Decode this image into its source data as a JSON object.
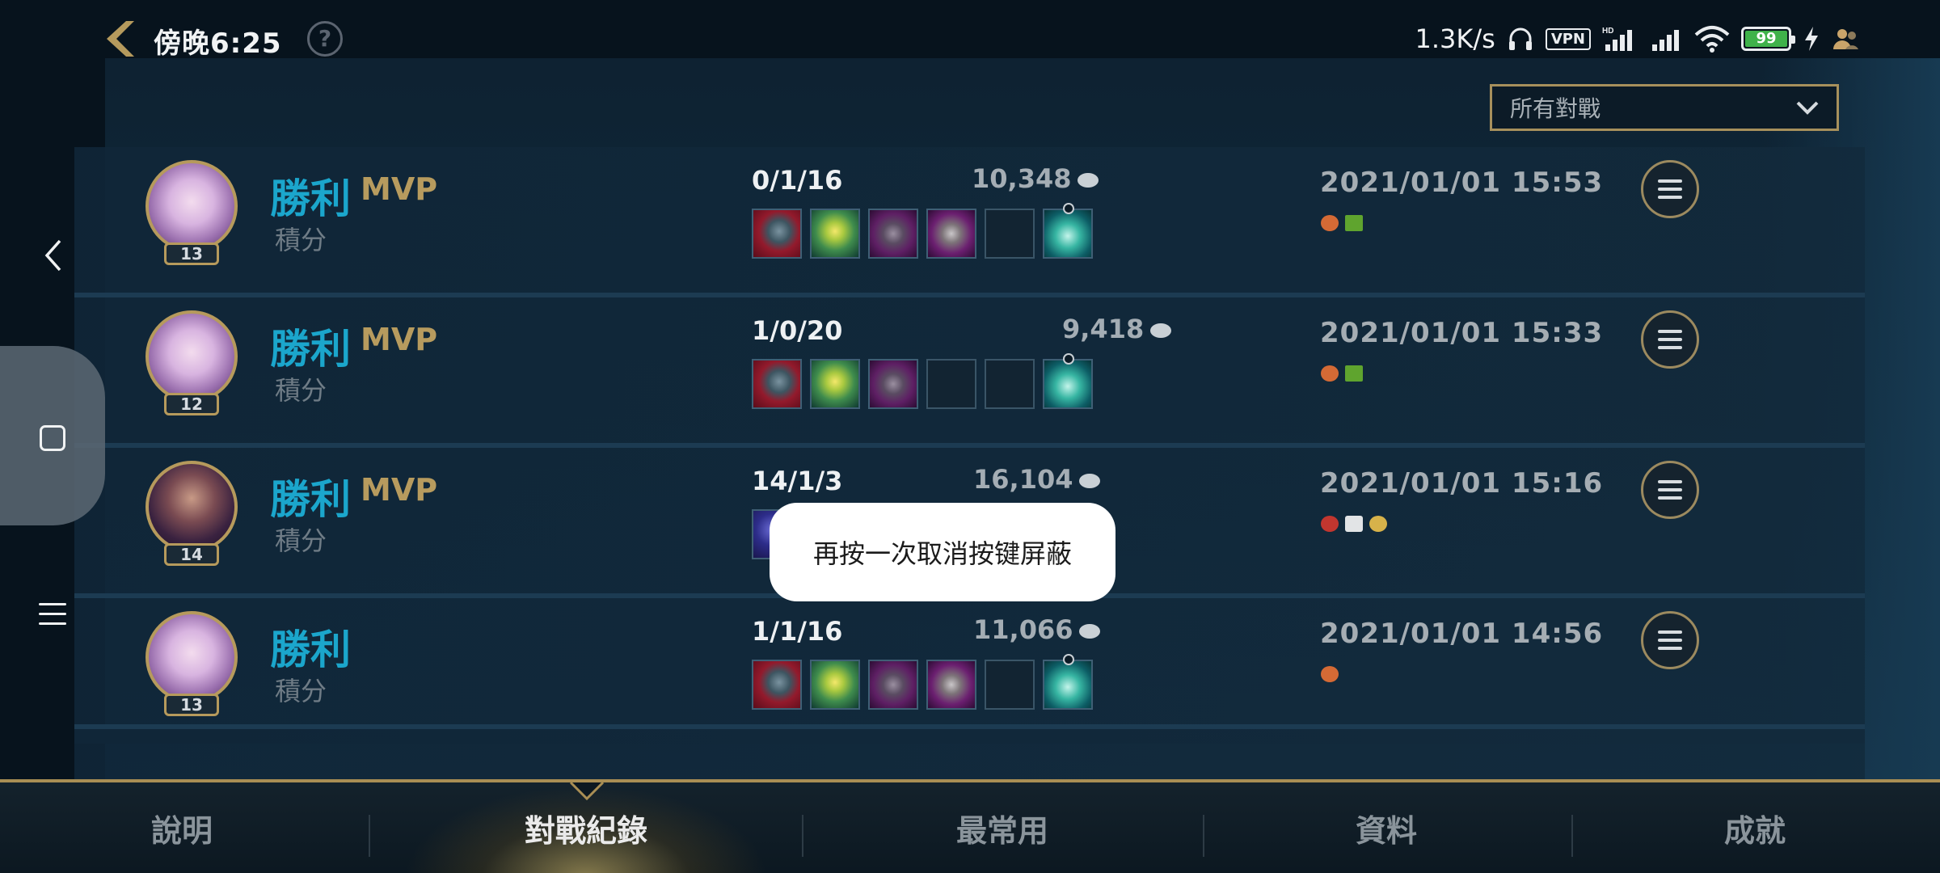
{
  "status_bar": {
    "time": "傍晚6:25",
    "net_speed": "1.3K/s",
    "vpn": "VPN",
    "battery": "99"
  },
  "filter": {
    "selected": "所有對戰"
  },
  "matches": [
    {
      "result": "勝利",
      "mvp": "MVP",
      "mode": "積分",
      "level": "13",
      "kda": "0/1/16",
      "gold": "10,348",
      "date": "2021/01/01 15:53"
    },
    {
      "result": "勝利",
      "mvp": "MVP",
      "mode": "積分",
      "level": "12",
      "kda": "1/0/20",
      "gold": "9,418",
      "date": "2021/01/01 15:33"
    },
    {
      "result": "勝利",
      "mvp": "MVP",
      "mode": "積分",
      "level": "14",
      "kda": "14/1/3",
      "gold": "16,104",
      "date": "2021/01/01 15:16"
    },
    {
      "result": "勝利",
      "mvp": "",
      "mode": "積分",
      "level": "13",
      "kda": "1/1/16",
      "gold": "11,066",
      "date": "2021/01/01 14:56"
    }
  ],
  "toast": "再按一次取消按键屏蔽",
  "tabs": [
    "說明",
    "對戰紀錄",
    "最常用",
    "資料",
    "成就"
  ],
  "colors": {
    "accent_gold": "#a98e54",
    "win_blue": "#1ba6cc"
  }
}
